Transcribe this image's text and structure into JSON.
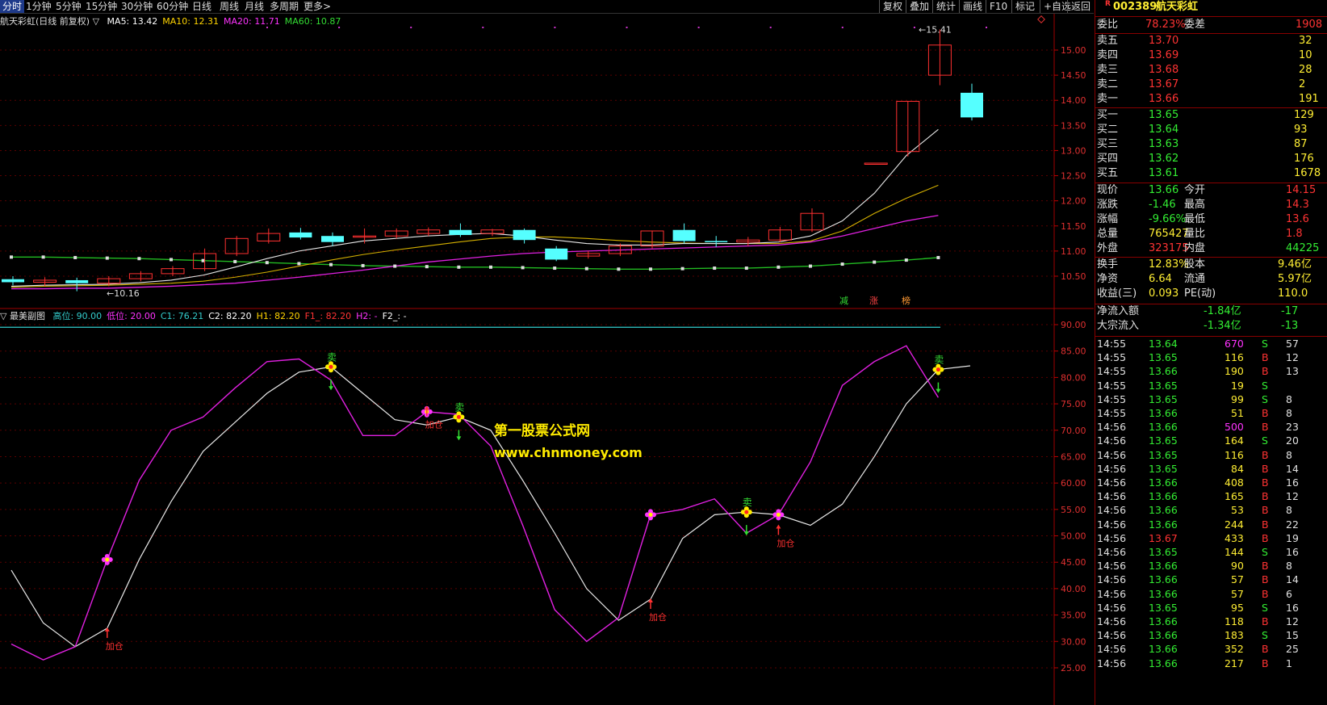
{
  "toolbar": {
    "periods": [
      "分时",
      "1分钟",
      "5分钟",
      "15分钟",
      "30分钟",
      "60分钟",
      "日线",
      "周线",
      "月线",
      "多周期",
      "更多>"
    ],
    "buttons": [
      "复权",
      "叠加",
      "统计",
      "画线",
      "F10",
      "标记",
      "+自选",
      "返回"
    ]
  },
  "main_chart": {
    "title": "航天彩虹(日线 前复权) ▽",
    "ma": [
      {
        "label": "MA5: 13.42",
        "color": "#ffffff"
      },
      {
        "label": "MA10: 12.31",
        "color": "#ffd400"
      },
      {
        "label": "MA20: 11.71",
        "color": "#ff33ff"
      },
      {
        "label": "MA60: 10.87",
        "color": "#33dd33"
      }
    ],
    "y_ticks": [
      "15.00",
      "14.50",
      "14.00",
      "13.50",
      "13.00",
      "12.50",
      "12.00",
      "11.50",
      "11.00",
      "10.50"
    ],
    "high_label": "15.41",
    "low_label": "10.16",
    "tags": [
      "减",
      "涨",
      "榜"
    ],
    "candles": [
      {
        "o": 10.44,
        "c": 10.38,
        "h": 10.5,
        "l": 10.32
      },
      {
        "o": 10.38,
        "c": 10.42,
        "h": 10.48,
        "l": 10.3
      },
      {
        "o": 10.42,
        "c": 10.36,
        "h": 10.47,
        "l": 10.2
      },
      {
        "o": 10.36,
        "c": 10.45,
        "h": 10.5,
        "l": 10.3
      },
      {
        "o": 10.45,
        "c": 10.55,
        "h": 10.6,
        "l": 10.4
      },
      {
        "o": 10.55,
        "c": 10.65,
        "h": 10.7,
        "l": 10.5
      },
      {
        "o": 10.65,
        "c": 10.95,
        "h": 11.05,
        "l": 10.6
      },
      {
        "o": 10.95,
        "c": 11.25,
        "h": 11.3,
        "l": 10.9
      },
      {
        "o": 11.2,
        "c": 11.35,
        "h": 11.45,
        "l": 11.15
      },
      {
        "o": 11.37,
        "c": 11.27,
        "h": 11.46,
        "l": 11.23
      },
      {
        "o": 11.3,
        "c": 11.18,
        "h": 11.37,
        "l": 11.1
      },
      {
        "o": 11.3,
        "c": 11.3,
        "h": 11.45,
        "l": 11.15
      },
      {
        "o": 11.3,
        "c": 11.4,
        "h": 11.45,
        "l": 11.25
      },
      {
        "o": 11.35,
        "c": 11.42,
        "h": 11.47,
        "l": 11.3
      },
      {
        "o": 11.42,
        "c": 11.32,
        "h": 11.55,
        "l": 11.28
      },
      {
        "o": 11.35,
        "c": 11.42,
        "h": 11.44,
        "l": 11.3
      },
      {
        "o": 11.42,
        "c": 11.22,
        "h": 11.45,
        "l": 11.15
      },
      {
        "o": 11.05,
        "c": 10.83,
        "h": 11.1,
        "l": 10.8
      },
      {
        "o": 10.9,
        "c": 10.95,
        "h": 11.0,
        "l": 10.85
      },
      {
        "o": 10.95,
        "c": 11.1,
        "h": 11.15,
        "l": 10.9
      },
      {
        "o": 11.1,
        "c": 11.4,
        "h": 11.4,
        "l": 11.05
      },
      {
        "o": 11.42,
        "c": 11.2,
        "h": 11.55,
        "l": 11.15
      },
      {
        "o": 11.2,
        "c": 11.18,
        "h": 11.3,
        "l": 11.08
      },
      {
        "o": 11.18,
        "c": 11.22,
        "h": 11.28,
        "l": 11.1
      },
      {
        "o": 11.22,
        "c": 11.42,
        "h": 11.48,
        "l": 11.18
      },
      {
        "o": 11.42,
        "c": 11.75,
        "h": 11.85,
        "l": 11.38
      },
      null,
      {
        "o": 12.75,
        "c": 12.75,
        "h": 12.75,
        "l": 12.75
      },
      {
        "o": 12.98,
        "c": 13.98,
        "h": 13.98,
        "l": 12.88
      },
      {
        "o": 14.5,
        "c": 15.1,
        "h": 15.41,
        "l": 14.3
      },
      {
        "o": 14.15,
        "c": 13.66,
        "h": 14.33,
        "l": 13.6
      }
    ],
    "ma5": [
      10.3,
      10.32,
      10.33,
      10.34,
      10.37,
      10.42,
      10.52,
      10.68,
      10.85,
      11.0,
      11.1,
      11.2,
      11.25,
      11.3,
      11.33,
      11.35,
      11.3,
      11.22,
      11.15,
      11.12,
      11.12,
      11.15,
      11.15,
      11.15,
      11.18,
      11.3,
      11.6,
      12.15,
      12.9,
      13.42
    ],
    "ma10": [
      10.28,
      10.3,
      10.31,
      10.32,
      10.34,
      10.36,
      10.4,
      10.48,
      10.58,
      10.7,
      10.82,
      10.93,
      11.02,
      11.1,
      11.18,
      11.25,
      11.28,
      11.28,
      11.25,
      11.21,
      11.18,
      11.16,
      11.15,
      11.15,
      11.15,
      11.2,
      11.4,
      11.75,
      12.05,
      12.31
    ],
    "ma20": [
      10.25,
      10.25,
      10.26,
      10.26,
      10.28,
      10.3,
      10.33,
      10.36,
      10.42,
      10.48,
      10.55,
      10.62,
      10.7,
      10.78,
      10.84,
      10.9,
      10.95,
      10.98,
      11.0,
      11.02,
      11.04,
      11.06,
      11.08,
      11.1,
      11.12,
      11.18,
      11.3,
      11.45,
      11.6,
      11.71
    ],
    "ma60": [
      10.88,
      10.88,
      10.87,
      10.86,
      10.85,
      10.83,
      10.81,
      10.79,
      10.77,
      10.75,
      10.73,
      10.71,
      10.7,
      10.69,
      10.68,
      10.68,
      10.67,
      10.66,
      10.65,
      10.64,
      10.64,
      10.65,
      10.66,
      10.66,
      10.68,
      10.7,
      10.74,
      10.78,
      10.82,
      10.87
    ]
  },
  "sub_chart": {
    "title": "▽ 最美副图",
    "params": [
      {
        "label": "高位: 90.00",
        "color": "#33cccc"
      },
      {
        "label": "低位: 20.00",
        "color": "#ff33ff"
      },
      {
        "label": "C1: 76.21",
        "color": "#33cccc"
      },
      {
        "label": "C2: 82.20",
        "color": "#ffffff"
      },
      {
        "label": "H1: 82.20",
        "color": "#ffd400"
      },
      {
        "label": "F1_: 82.20",
        "color": "#ff3333"
      },
      {
        "label": "H2: -",
        "color": "#ff33ff"
      },
      {
        "label": "F2_: -",
        "color": "#ffffff"
      }
    ],
    "y_ticks": [
      "90.00",
      "85.00",
      "80.00",
      "75.00",
      "70.00",
      "65.00",
      "60.00",
      "55.00",
      "50.00",
      "45.00",
      "40.00",
      "35.00",
      "30.00",
      "25.00"
    ],
    "white_line": [
      43.5,
      33.5,
      29.0,
      32.5,
      45.5,
      56.5,
      66.0,
      71.5,
      77.0,
      81.0,
      82.0,
      77.0,
      72.0,
      71.0,
      72.5,
      70.0,
      60.5,
      50.5,
      40.0,
      34.0,
      38.0,
      49.5,
      54.0,
      54.5,
      54.0,
      52.0,
      56.0,
      65.0,
      75.0,
      81.5,
      82.2
    ],
    "magenta_line": [
      29.5,
      26.5,
      29.0,
      45.5,
      60.5,
      70.0,
      72.5,
      78.0,
      83.0,
      83.5,
      79.5,
      69.0,
      69.0,
      73.5,
      73.0,
      67.0,
      52.0,
      36.0,
      30.0,
      34.5,
      54.0,
      55.0,
      57.0,
      50.5,
      54.0,
      64.0,
      78.5,
      83.0,
      86.0,
      76.2
    ],
    "buy_label": "加仓",
    "sell_label": "卖",
    "watermark_name": "第一股票公式网",
    "watermark_url": "www.chnmoney.com"
  },
  "quote": {
    "code": "002389",
    "name": "航天彩虹",
    "webi_label": "委比",
    "webi_value": "78.23%",
    "wecha_label": "委差",
    "wecha_value": "1908",
    "sells": [
      {
        "label": "卖五",
        "price": "13.70",
        "vol": "32"
      },
      {
        "label": "卖四",
        "price": "13.69",
        "vol": "10"
      },
      {
        "label": "卖三",
        "price": "13.68",
        "vol": "28"
      },
      {
        "label": "卖二",
        "price": "13.67",
        "vol": "2"
      },
      {
        "label": "卖一",
        "price": "13.66",
        "vol": "191"
      }
    ],
    "buys": [
      {
        "label": "买一",
        "price": "13.65",
        "vol": "129"
      },
      {
        "label": "买二",
        "price": "13.64",
        "vol": "93"
      },
      {
        "label": "买三",
        "price": "13.63",
        "vol": "87"
      },
      {
        "label": "买四",
        "price": "13.62",
        "vol": "176"
      },
      {
        "label": "买五",
        "price": "13.61",
        "vol": "1678"
      }
    ],
    "stats": [
      {
        "l1": "现价",
        "v1": "13.66",
        "l2": "今开",
        "v2": "14.15"
      },
      {
        "l1": "涨跌",
        "v1": "-1.46",
        "l2": "最高",
        "v2": "14.3"
      },
      {
        "l1": "涨幅",
        "v1": "-9.66%",
        "l2": "最低",
        "v2": "13.6"
      },
      {
        "l1": "总量",
        "v1": "765427",
        "l2": "量比",
        "v2": "1.8"
      },
      {
        "l1": "外盘",
        "v1": "323175",
        "l2": "内盘",
        "v2": "44225"
      }
    ],
    "stats2": [
      {
        "l1": "换手",
        "v1": "12.83%",
        "l2": "股本",
        "v2": "9.46亿"
      },
      {
        "l1": "净资",
        "v1": "6.64",
        "l2": "流通",
        "v2": "5.97亿"
      },
      {
        "l1": "收益(三)",
        "v1": "0.093",
        "l2": "PE(动)",
        "v2": "110.0"
      }
    ],
    "flows": [
      {
        "label": "净流入额",
        "value": "-1.84亿",
        "pct": "-17"
      },
      {
        "label": "大宗流入",
        "value": "-1.34亿",
        "pct": "-13"
      }
    ],
    "ticks": [
      {
        "t": "14:55",
        "p": "13.64",
        "v": "670",
        "s": "S",
        "n": "57"
      },
      {
        "t": "14:55",
        "p": "13.65",
        "v": "116",
        "s": "B",
        "n": "12"
      },
      {
        "t": "14:55",
        "p": "13.66",
        "v": "190",
        "s": "B",
        "n": "13"
      },
      {
        "t": "14:55",
        "p": "13.65",
        "v": "19",
        "s": "S",
        "n": ""
      },
      {
        "t": "14:55",
        "p": "13.65",
        "v": "99",
        "s": "S",
        "n": "8"
      },
      {
        "t": "14:55",
        "p": "13.66",
        "v": "51",
        "s": "B",
        "n": "8"
      },
      {
        "t": "14:56",
        "p": "13.66",
        "v": "500",
        "s": "B",
        "n": "23"
      },
      {
        "t": "14:56",
        "p": "13.65",
        "v": "164",
        "s": "S",
        "n": "20"
      },
      {
        "t": "14:56",
        "p": "13.65",
        "v": "116",
        "s": "B",
        "n": "8"
      },
      {
        "t": "14:56",
        "p": "13.65",
        "v": "84",
        "s": "B",
        "n": "14"
      },
      {
        "t": "14:56",
        "p": "13.66",
        "v": "408",
        "s": "B",
        "n": "16"
      },
      {
        "t": "14:56",
        "p": "13.66",
        "v": "165",
        "s": "B",
        "n": "12"
      },
      {
        "t": "14:56",
        "p": "13.66",
        "v": "53",
        "s": "B",
        "n": "8"
      },
      {
        "t": "14:56",
        "p": "13.66",
        "v": "244",
        "s": "B",
        "n": "22"
      },
      {
        "t": "14:56",
        "p": "13.67",
        "v": "433",
        "s": "B",
        "n": "19"
      },
      {
        "t": "14:56",
        "p": "13.65",
        "v": "144",
        "s": "S",
        "n": "16"
      },
      {
        "t": "14:56",
        "p": "13.66",
        "v": "90",
        "s": "B",
        "n": "8"
      },
      {
        "t": "14:56",
        "p": "13.66",
        "v": "57",
        "s": "B",
        "n": "14"
      },
      {
        "t": "14:56",
        "p": "13.66",
        "v": "57",
        "s": "B",
        "n": "6"
      },
      {
        "t": "14:56",
        "p": "13.65",
        "v": "95",
        "s": "S",
        "n": "16"
      },
      {
        "t": "14:56",
        "p": "13.66",
        "v": "118",
        "s": "B",
        "n": "12"
      },
      {
        "t": "14:56",
        "p": "13.66",
        "v": "183",
        "s": "S",
        "n": "15"
      },
      {
        "t": "14:56",
        "p": "13.66",
        "v": "352",
        "s": "B",
        "n": "25"
      },
      {
        "t": "14:56",
        "p": "13.66",
        "v": "217",
        "s": "B",
        "n": "1"
      }
    ]
  }
}
